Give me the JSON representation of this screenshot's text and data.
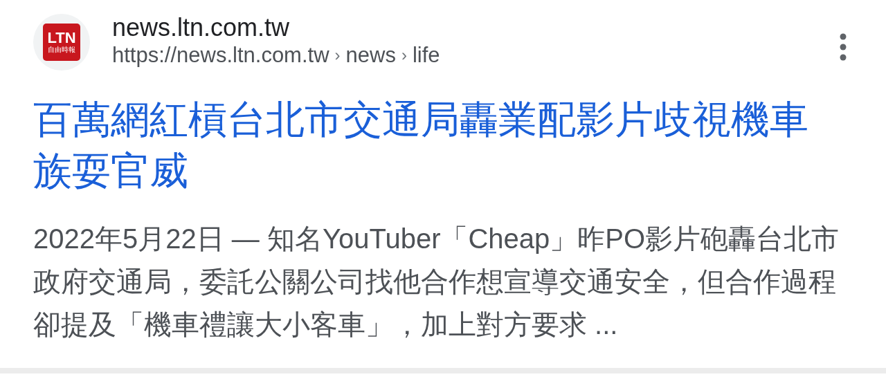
{
  "result": {
    "logo": {
      "title": "LTN",
      "subtitle": "自由時報"
    },
    "site_name": "news.ltn.com.tw",
    "url": {
      "base": "https://news.ltn.com.tw",
      "crumbs": [
        "news",
        "life"
      ]
    },
    "separator": "›",
    "title": "百萬網紅槓台北市交通局轟業配影片歧視機車族耍官威",
    "snippet": "2022年5月22日 — 知名YouTuber「Cheap」昨PO影片砲轟台北市政府交通局，委託公關公司找他合作想宣導交通安全，但合作過程卻提及「機車禮讓大小客車」，加上對方要求 ..."
  }
}
